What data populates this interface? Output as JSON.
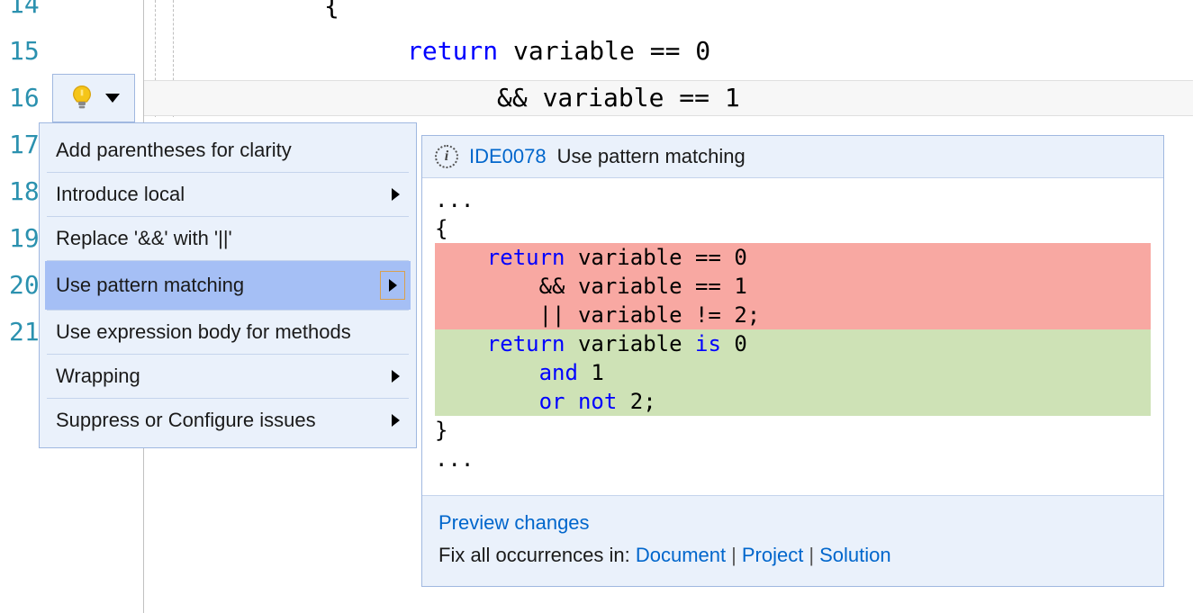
{
  "gutter": {
    "lines": [
      "14",
      "15",
      "16",
      "17",
      "18",
      "19",
      "20",
      "21"
    ]
  },
  "code": {
    "brace": "{",
    "line1_kw": "return",
    "line1_rest": " variable == 0",
    "line2": "&& variable == 1"
  },
  "menu": {
    "items": [
      {
        "label": "Add parentheses for clarity",
        "submenu": false
      },
      {
        "label": "Introduce local",
        "submenu": true
      },
      {
        "label": "Replace '&&' with '||'",
        "submenu": false
      },
      {
        "label": "Use pattern matching",
        "submenu": true,
        "highlighted": true
      },
      {
        "label": "Use expression body for methods",
        "submenu": false
      },
      {
        "label": "Wrapping",
        "submenu": true
      },
      {
        "label": "Suppress or Configure issues",
        "submenu": true
      }
    ]
  },
  "preview": {
    "diagnostic_id": "IDE0078",
    "diagnostic_msg": "Use pattern matching",
    "diff": {
      "pre1": "...",
      "pre2": "{",
      "rem1_kw": "return",
      "rem1_rest": " variable == 0",
      "rem2": "        && variable == 1",
      "rem3": "        || variable != 2;",
      "add1_kw": "return",
      "add1_mid": " variable ",
      "add1_is": "is",
      "add1_end": " 0",
      "add2_and": "and",
      "add2_end": " 1",
      "add3_or": "or",
      "add3_not": "not",
      "add3_end": " 2;",
      "post1": "}",
      "post2": "..."
    },
    "footer": {
      "preview_link": "Preview changes",
      "fix_text": "Fix all occurrences in: ",
      "document": "Document",
      "project": "Project",
      "solution": "Solution"
    }
  }
}
